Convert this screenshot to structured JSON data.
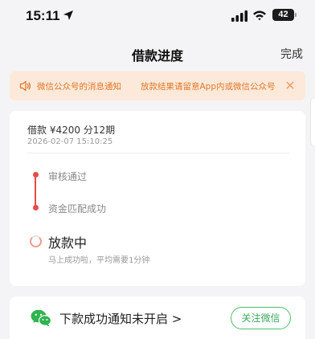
{
  "status_bar": {
    "time": "15:11",
    "battery": "42"
  },
  "nav": {
    "title": "借款进度",
    "done_label": "完成"
  },
  "notice": {
    "segments": [
      "微信公众号的消息通知",
      "放款结果请留意App内或微信公众号"
    ],
    "icon": "speaker-icon",
    "close_icon": "close-icon"
  },
  "loan": {
    "summary": "借款 ¥4200  分12期",
    "time": "2026-02-07 15:10:25"
  },
  "timeline": {
    "steps": [
      {
        "label": "审核通过",
        "state": "done"
      },
      {
        "label": "资金匹配成功",
        "state": "done"
      }
    ],
    "current": {
      "label": "放款中",
      "sub": "马上成功啦，平均需要1分钟"
    },
    "accent": "#e84a4a"
  },
  "notify": {
    "text": "下款成功通知未开启 >",
    "button": "关注微信",
    "icon": "wechat-icon",
    "accent": "#3aa85a"
  }
}
